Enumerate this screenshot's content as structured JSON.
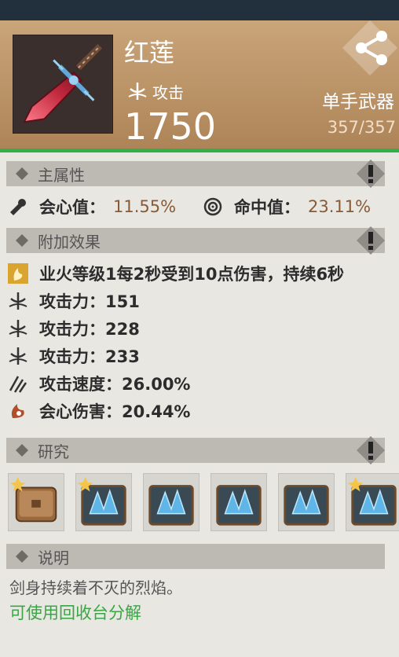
{
  "header": {
    "item_name": "红莲",
    "attack_label": "攻击",
    "attack_value": "1750",
    "weapon_type": "单手武器",
    "durability": "357/357"
  },
  "sections": {
    "main_attr_title": "主属性",
    "extra_effect_title": "附加效果",
    "research_title": "研究",
    "description_title": "说明"
  },
  "main_attributes": [
    {
      "label": "会心值：",
      "value": "11.55%",
      "icon": "crit-icon"
    },
    {
      "label": "命中值：",
      "value": "23.11%",
      "icon": "accuracy-icon"
    }
  ],
  "extra_effects": [
    {
      "text": "业火等级1每2秒受到10点伤害，持续6秒",
      "icon": "hellfire-icon"
    },
    {
      "text": "攻击力：151",
      "icon": "attack-icon"
    },
    {
      "text": "攻击力：228",
      "icon": "attack-icon"
    },
    {
      "text": "攻击力：233",
      "icon": "attack-icon"
    },
    {
      "text": "攻击速度：26.00%",
      "icon": "attack-speed-icon"
    },
    {
      "text": "会心伤害：20.44%",
      "icon": "crit-damage-icon"
    }
  ],
  "research_items": [
    "leather-book-icon",
    "blue-crystal-book-icon",
    "blue-crystal-book-icon",
    "blue-crystal-book-icon",
    "blue-crystal-book-icon",
    "blue-crystal-book-icon"
  ],
  "description": {
    "text": "剑身持续着不灭的烈焰。",
    "recycle_hint": "可使用回收台分解"
  },
  "colors": {
    "header_gradient_top": "#caa57a",
    "header_gradient_bottom": "#ad8457",
    "accent_green": "#31b04a",
    "value_brown": "#8a5a36",
    "section_bar": "#bdbab4"
  }
}
